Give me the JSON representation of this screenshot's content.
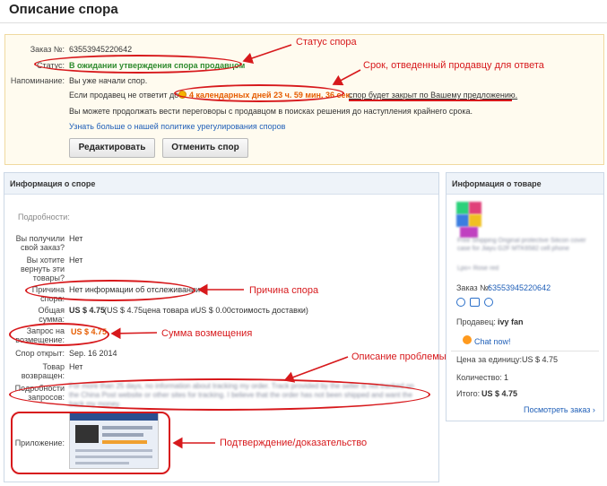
{
  "page": {
    "title": "Описание спора"
  },
  "status_block": {
    "order_label": "Заказ №:",
    "order_number": "63553945220642",
    "status_label": "Статус:",
    "status_value": "В ожидании утверждения спора продавцом",
    "reminder_label": "Напоминание:",
    "reminder_text": "Вы уже начали спор.",
    "deadline_prefix": "Если продавец не ответит до",
    "deadline_value": "4 календарных дней 23 ч. 59 мин. 36 сек.",
    "deadline_suffix": "спор будет закрыт по Вашему предложению.",
    "negotiate_text": "Вы можете продолжать вести переговоры с продавцом в поисках решения до наступления крайнего срока.",
    "policy_link": "Узнать больше о нашей политике урегулирования споров",
    "edit_button": "Редактировать",
    "cancel_button": "Отменить спор"
  },
  "annotations": {
    "status": "Статус спора",
    "deadline": "Срок, отведенный продавцу для ответа",
    "reason": "Причина спора",
    "refund": "Сумма возмещения",
    "problem": "Описание проблемы",
    "evidence": "Подтверждение/доказательство"
  },
  "dispute_info": {
    "header": "Информация о споре",
    "details_label": "Подробности:",
    "received_label": "Вы получили свой заказ?",
    "received_value": "Нет",
    "return_label": "Вы хотите вернуть эти товары?",
    "return_value": "Нет",
    "reason_label": "Причина спора:",
    "reason_value": "Нет информации об отслеживании",
    "total_label": "Общая сумма:",
    "total_value": "US $ 4.75",
    "total_detail": "(US $ 4.75цена товара иUS $ 0.00стоимость доставки)",
    "refund_label": "Запрос на возмещение:",
    "refund_value": "US $ 4.75",
    "opened_label": "Спор открыт:",
    "opened_value": "Sep. 16 2014",
    "returned_label": "Товар возвращен:",
    "returned_value": "Нет",
    "request_label": "Подробности запросов:",
    "request_text": "For more than 25 days, no information about tracking my order. Track provided by the seller is not tracked on the China Post website or other sites for tracking. I believe that the order has not been shipped and want the back my money.",
    "attachment_label": "Приложение:"
  },
  "product_info": {
    "header": "Информация о товаре",
    "product_title": "Free Shipping Original protective Silicon cover case for Jiayu G2F MTK6582 cell phone",
    "product_sub": "Lpo+ Rose red",
    "order_label": "Заказ №:",
    "order_number": "63553945220642",
    "seller_label": "Продавец:",
    "seller_name": "ivy fan",
    "chat": "Chat now!",
    "unit_price_label": "Цена за единицу:",
    "unit_price": "US $ 4.75",
    "qty_label": "Количество:",
    "qty": "1",
    "total_label": "Итого:",
    "total": "US $ 4.75",
    "view_order": "Посмотреть заказ ›"
  },
  "colors": {
    "accent_red": "#d7191c",
    "link_blue": "#1f5fb8",
    "status_green": "#2e8b2e",
    "deadline_orange": "#e65c00"
  }
}
